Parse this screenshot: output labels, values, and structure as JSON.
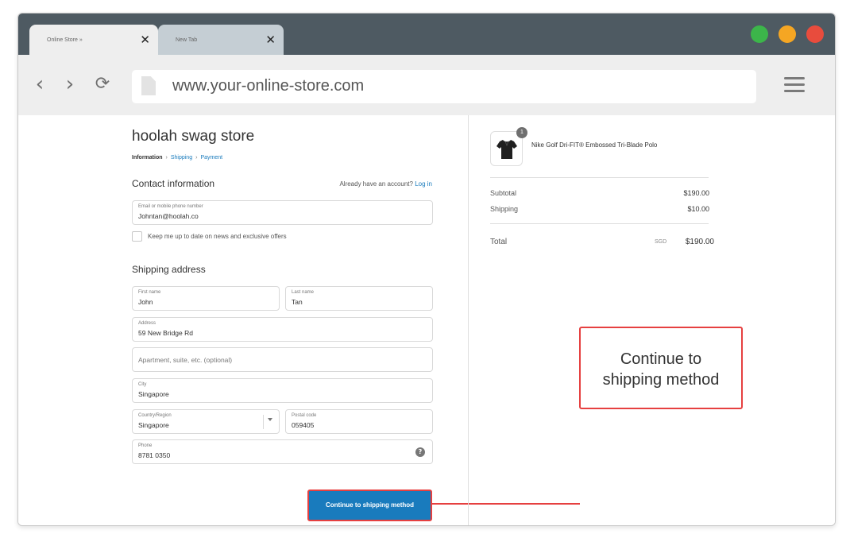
{
  "browser": {
    "tabs": [
      {
        "title": "Online Store  »",
        "close": "✕"
      },
      {
        "title": "New Tab",
        "close": "✕"
      }
    ],
    "window_dots": [
      "#3cb54a",
      "#f5a623",
      "#e84c3d"
    ],
    "nav": {
      "back": "‹",
      "forward": "›",
      "reload": "⟳"
    },
    "url": "www.your-online-store.com",
    "icons": {
      "page": "page-icon",
      "menu": "hamburger-menu-icon"
    }
  },
  "checkout": {
    "store_name": "hoolah swag store",
    "breadcrumb": {
      "current": "Information",
      "step2": "Shipping",
      "step3": "Payment",
      "separator": "›"
    },
    "contact": {
      "title": "Contact information",
      "account_prompt": "Already have an account?",
      "login_link": "Log in",
      "email_label": "Email or mobile phone number",
      "email_value": "Johntan@hoolah.co",
      "newsletter_label": "Keep me up to date on news and exclusive offers"
    },
    "shipping": {
      "title": "Shipping address",
      "first_name_label": "First name",
      "first_name_value": "John",
      "last_name_label": "Last name",
      "last_name_value": "Tan",
      "address_label": "Address",
      "address_value": "59 New Bridge Rd",
      "apartment_placeholder": "Apartment, suite, etc. (optional)",
      "city_label": "City",
      "city_value": "Singapore",
      "country_label": "Country/Region",
      "country_value": "Singapore",
      "postal_label": "Postal code",
      "postal_value": "059405",
      "phone_label": "Phone",
      "phone_value": "8781 0350",
      "help_glyph": "?"
    },
    "continue_button": "Continue to shipping method"
  },
  "order_summary": {
    "product": {
      "name": "Nike Golf Dri-FIT® Embossed Tri-Blade Polo",
      "quantity": "1",
      "icon": "polo-shirt-icon"
    },
    "subtotal_label": "Subtotal",
    "subtotal_value": "$190.00",
    "shipping_label": "Shipping",
    "shipping_value": "$10.00",
    "total_label": "Total",
    "total_currency": "SGD",
    "total_value": "$190.00"
  },
  "callout": {
    "line1": "Continue to",
    "line2": "shipping method"
  },
  "colors": {
    "accent": "#197bbd",
    "highlight": "#e64040",
    "titlebar": "#4e5a62"
  }
}
